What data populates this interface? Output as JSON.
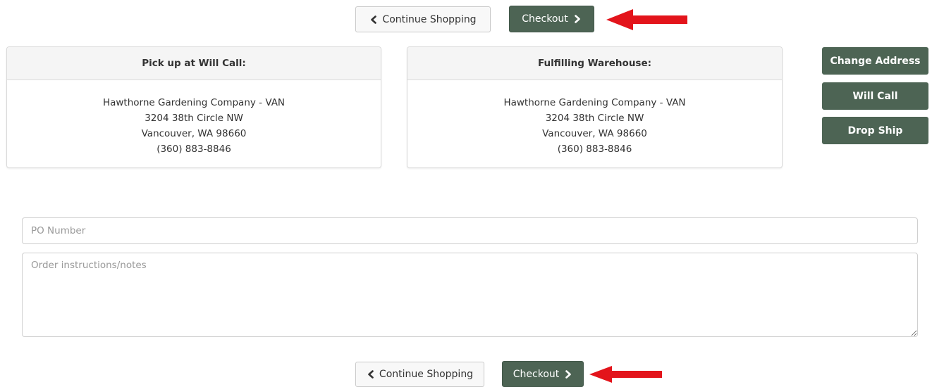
{
  "top_nav": {
    "continue_label": "Continue Shopping",
    "checkout_label": "Checkout"
  },
  "pickup_panel": {
    "title": "Pick up at Will Call:",
    "lines": [
      "Hawthorne Gardening Company - VAN",
      "3204 38th Circle NW",
      "Vancouver, WA 98660",
      "(360) 883-8846"
    ]
  },
  "warehouse_panel": {
    "title": "Fulfilling Warehouse:",
    "lines": [
      "Hawthorne Gardening Company - VAN",
      "3204 38th Circle NW",
      "Vancouver, WA 98660",
      "(360) 883-8846"
    ]
  },
  "side_buttons": {
    "change_address": "Change Address",
    "will_call": "Will Call",
    "drop_ship": "Drop Ship"
  },
  "form": {
    "po_placeholder": "PO Number",
    "po_value": "",
    "notes_placeholder": "Order instructions/notes",
    "notes_value": ""
  },
  "bottom_nav": {
    "continue_label": "Continue Shopping",
    "checkout_label": "Checkout"
  },
  "colors": {
    "primary_button": "#4d6454",
    "annotation_arrow": "#e3141b"
  },
  "icons": [
    "chevron-left-icon",
    "chevron-right-icon"
  ]
}
